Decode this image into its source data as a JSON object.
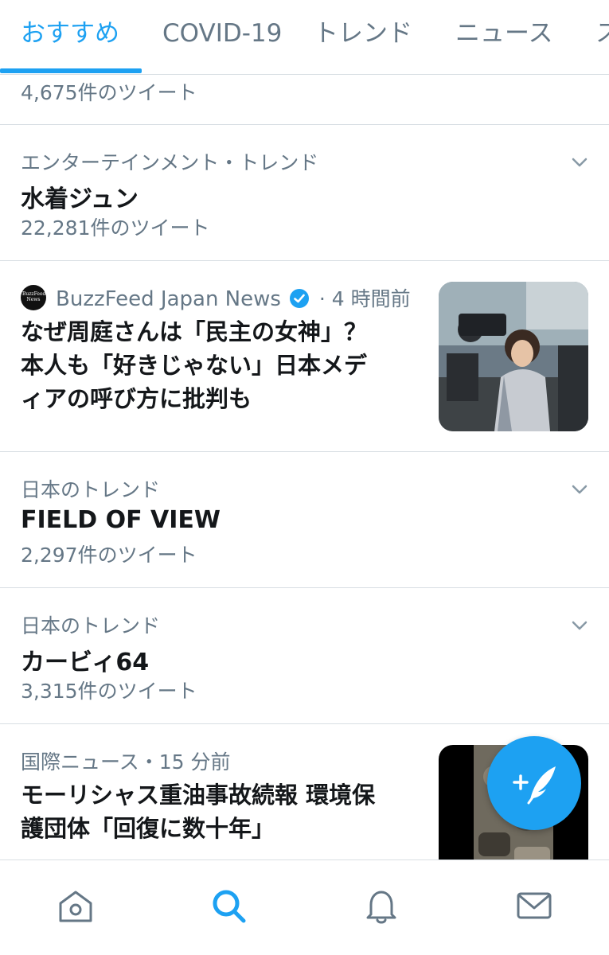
{
  "tabs": [
    {
      "label": "おすすめ",
      "active": true
    },
    {
      "label": "COVID-19",
      "active": false
    },
    {
      "label": "トレンド",
      "active": false
    },
    {
      "label": "ニュース",
      "active": false
    },
    {
      "label": "ス",
      "active": false
    }
  ],
  "feed": {
    "partial_row": {
      "count": "4,675件のツイート"
    },
    "trend1": {
      "category": "エンターテインメント・トレンド",
      "title": "水着ジュン",
      "count": "22,281件のツイート"
    },
    "news1": {
      "source_logo_text": "BuzzFeed News",
      "source": "BuzzFeed Japan News",
      "time": "· 4 時間前",
      "title_line1": "なぜ周庭さんは「民主の女神」？",
      "title_line2": "本人も「好きじゃない」日本メデ",
      "title_line3": "ィアの呼び方に批判も"
    },
    "trend2": {
      "category": "日本のトレンド",
      "title": "FIELD OF VIEW",
      "count": "2,297件のツイート"
    },
    "trend3": {
      "category": "日本のトレンド",
      "title": "カービィ64",
      "count": "3,315件のツイート"
    },
    "news2": {
      "meta": "国際ニュース・15 分前",
      "title_line1": "モーリシャス重油事故続報 環境保",
      "title_line2": "護団体「回復に数十年」"
    }
  },
  "colors": {
    "accent": "#1da1f2",
    "text_primary": "#14171a",
    "text_secondary": "#657786",
    "divider": "#d8dee3"
  },
  "icons": {
    "verified": "verified-badge-icon",
    "chevron": "chevron-down-icon",
    "home": "home-icon",
    "search": "search-icon",
    "notifications": "bell-icon",
    "messages": "mail-icon",
    "compose": "compose-tweet-icon"
  }
}
